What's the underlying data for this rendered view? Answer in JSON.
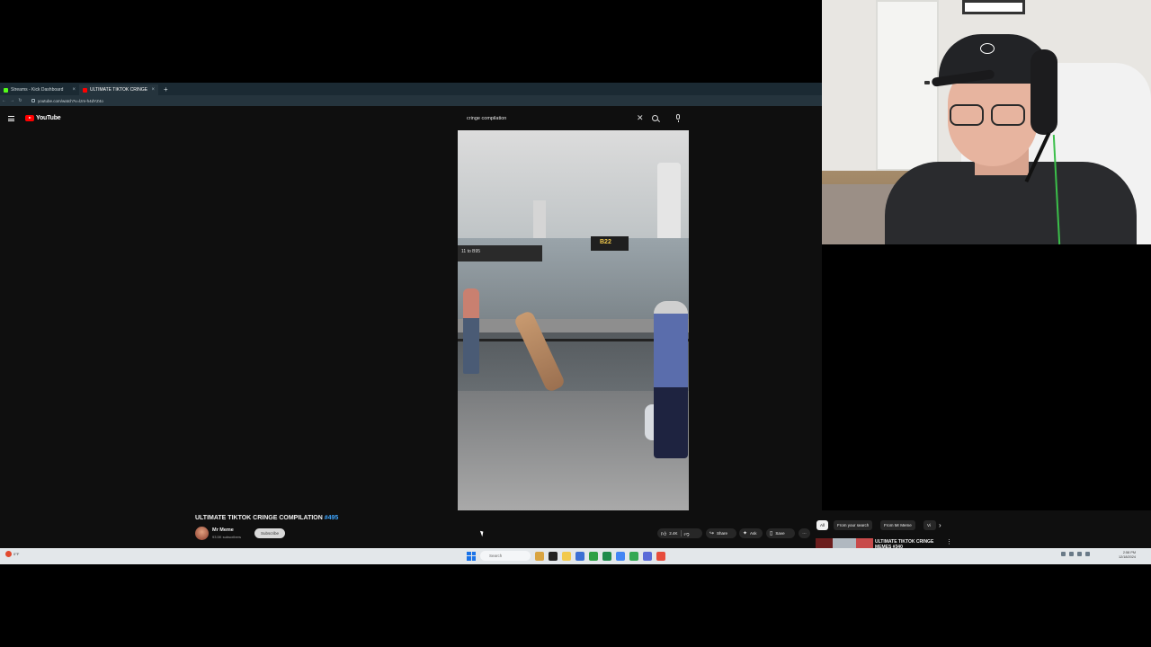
{
  "browser": {
    "tabs": [
      {
        "label": "Streams - Kick Dashboard",
        "color": "#53fc18"
      },
      {
        "label": "ULTIMATE TIKTOK CRINGE",
        "color": "#ff0000"
      }
    ],
    "new_tab": "+",
    "nav": {
      "back": "←",
      "forward": "→",
      "reload": "↻"
    },
    "url": "youtube.com/watch?v=lzm-h4dYZ4o"
  },
  "youtube": {
    "logo_text": "YouTube",
    "search_value": "cringe compilation",
    "search_placeholder": "Search",
    "clear_glyph": "✕"
  },
  "video_overlay": {
    "sign_gate_left": "11 to B95",
    "sign_gate_right": "B22"
  },
  "info": {
    "title": "ULTIMATE TIKTOK CRINGE COMPILATION ",
    "title_hashtag": "#495",
    "channel_name": "Mr Meme",
    "channel_subs": "93.5K subscribers",
    "subscribe_label": "Subscribe",
    "likes": "2.4K",
    "share_label": "Share",
    "ask_label": "Ask",
    "save_label": "Save",
    "more_glyph": "···",
    "chips": [
      "All",
      "From your search",
      "From Mr Meme",
      "Vi"
    ],
    "chip_arrow": "›",
    "rec_title": "ULTIMATE TIKTOK CRINGE MEMES #340"
  },
  "taskbar": {
    "weather_temp": "0°F",
    "weather_desc": "Cloudy",
    "search_placeholder": "Search",
    "clock_time": "2:58 PM",
    "clock_date": "12/18/2024",
    "app_colors": [
      "#d9a441",
      "#222222",
      "#f2c94c",
      "#3b6fd4",
      "#2ea043",
      "#1f8b4c",
      "#4285f4",
      "#5b6bd8",
      "#34a853",
      "#e74c3c"
    ]
  }
}
